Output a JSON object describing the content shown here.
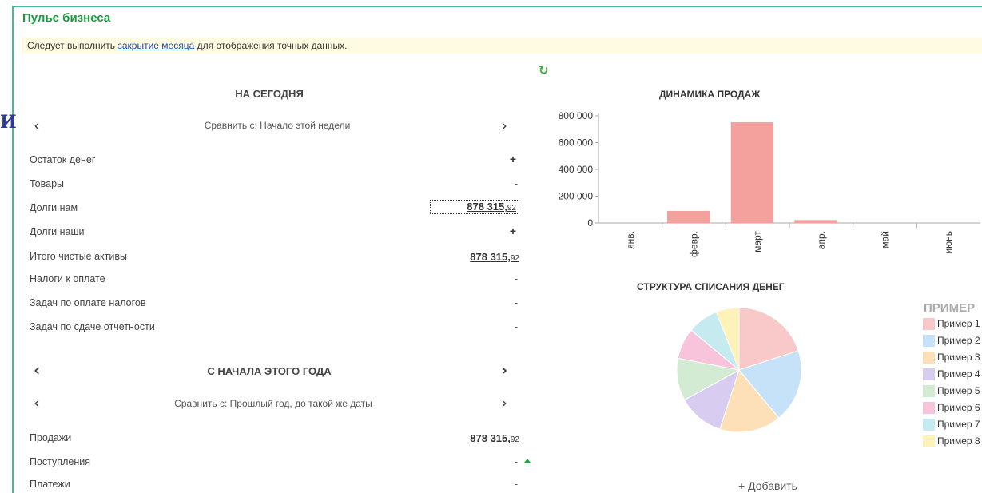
{
  "header": {
    "title": "Пульс бизнеса",
    "side_mark": "И"
  },
  "notice": {
    "before": "Следует выполнить ",
    "link": "закрытие месяца",
    "after": " для отображения точных данных."
  },
  "today": {
    "heading": "НА СЕГОДНЯ",
    "compare": "Сравнить с: Начало этой недели",
    "rows": [
      {
        "label": "Остаток денег",
        "value": "+"
      },
      {
        "label": "Товары",
        "value": "-"
      },
      {
        "label": "Долги нам",
        "value_main": "878 315,",
        "value_cents": "92"
      },
      {
        "label": "Долги наши",
        "value": "+"
      },
      {
        "label": "Итого чистые активы",
        "value_main": "878 315,",
        "value_cents": "92"
      },
      {
        "label": "Налоги к оплате",
        "value": "-"
      },
      {
        "label": "Задач по оплате налогов",
        "value": "-"
      },
      {
        "label": "Задач по сдаче отчетности",
        "value": "-"
      }
    ]
  },
  "year": {
    "heading": "С НАЧАЛА ЭТОГО ГОДА",
    "compare": "Сравнить с: Прошлый год, до такой же даты",
    "rows": [
      {
        "label": "Продажи",
        "value_main": "878 315,",
        "value_cents": "92"
      },
      {
        "label": "Поступления",
        "value": "-"
      },
      {
        "label": "Платежи",
        "value": "-"
      }
    ]
  },
  "sales_chart": {
    "title": "ДИНАМИКА ПРОДАЖ",
    "bar_color": "#f4a09c"
  },
  "chart_data": [
    {
      "type": "bar",
      "title": "ДИНАМИКА ПРОДАЖ",
      "categories": [
        "янв.",
        "февр.",
        "март",
        "апр.",
        "май",
        "июнь"
      ],
      "values": [
        0,
        90000,
        752000,
        22000,
        0,
        0
      ],
      "ylim": [
        0,
        800000
      ],
      "yticks": [
        "0",
        "200 000",
        "400 000",
        "600 000",
        "800 000"
      ],
      "tick_values": [
        0,
        200000,
        400000,
        600000,
        800000
      ]
    },
    {
      "type": "pie",
      "title": "СТРУКТУРА СПИСАНИЯ ДЕНЕГ",
      "legend_title": "ПРИМЕР",
      "legend_placement": "right",
      "labels": [
        "Пример 1",
        "Пример 2",
        "Пример 3",
        "Пример 4",
        "Пример 5",
        "Пример 6",
        "Пример 7",
        "Пример 8"
      ],
      "values": [
        20,
        19,
        16,
        12,
        11,
        8,
        8,
        6
      ],
      "colors": [
        "#f9c9c9",
        "#c6e2f8",
        "#fde0b8",
        "#d8cdf0",
        "#d2ebd2",
        "#f8c4dc",
        "#c5eaf0",
        "#fdf3b8"
      ]
    }
  ],
  "pie_chart": {
    "title": "СТРУКТУРА СПИСАНИЯ ДЕНЕГ"
  },
  "add_button": "+ Добавить"
}
